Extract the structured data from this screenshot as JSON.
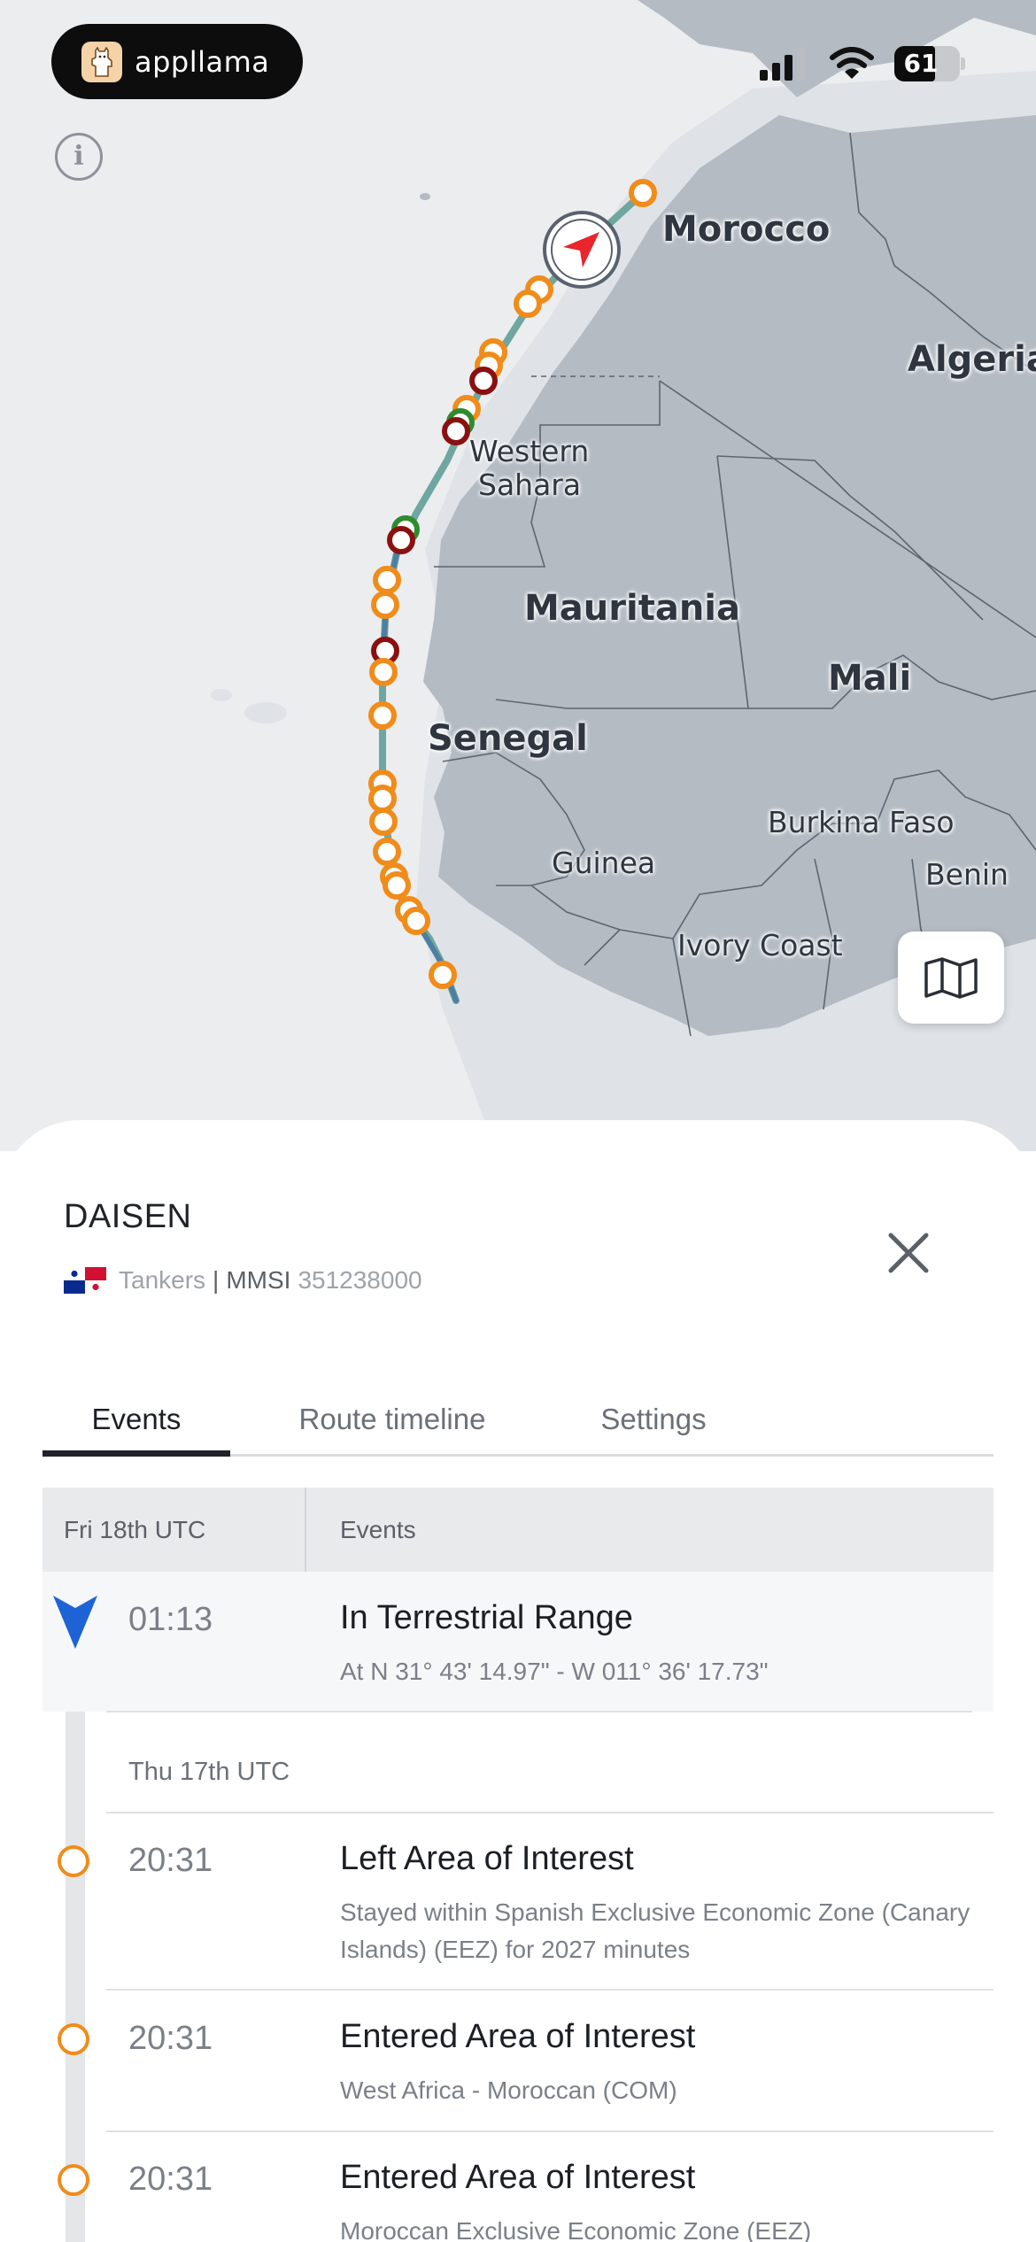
{
  "status_bar": {
    "app_badge": "appllama",
    "battery": "61"
  },
  "map": {
    "labels": {
      "morocco": "Morocco",
      "algeria": "Algeria",
      "western_sahara_1": "Western",
      "western_sahara_2": "Sahara",
      "mauritania": "Mauritania",
      "mali": "Mali",
      "senegal": "Senegal",
      "burkina_faso": "Burkina Faso",
      "guinea": "Guinea",
      "benin": "Benin",
      "ivory_coast": "Ivory Coast"
    },
    "colors": {
      "land": "#b4bbc3",
      "sea": "#ebedef",
      "route": "#6fa6a0",
      "event_orange": "#f08c1a",
      "event_red": "#8b1010",
      "event_green": "#2e8b2e",
      "vessel_marker": "#e8262b"
    }
  },
  "vessel": {
    "name": "DAISEN",
    "type": "Tankers",
    "separator": "|",
    "mmsi_label": "MMSI",
    "mmsi": "351238000",
    "flag": "panama-flag"
  },
  "tabs": [
    {
      "label": "Events"
    },
    {
      "label": "Route timeline"
    },
    {
      "label": "Settings"
    }
  ],
  "table": {
    "col_date": "Fri 18th UTC",
    "col_events": "Events"
  },
  "events": [
    {
      "time": "01:13",
      "title": "In Terrestrial Range",
      "desc": "At N 31° 43' 14.97\" - W 011° 36' 17.73\""
    },
    {
      "time": "20:31",
      "title": "Left Area of Interest",
      "desc": "Stayed within Spanish Exclusive Economic Zone (Canary Islands) (EEZ) for 2027 minutes"
    },
    {
      "time": "20:31",
      "title": "Entered Area of Interest",
      "desc": "West Africa - Moroccan (COM)"
    },
    {
      "time": "20:31",
      "title": "Entered Area of Interest",
      "desc": "Moroccan Exclusive Economic Zone (EEZ)"
    }
  ],
  "date_groups": {
    "thu": "Thu 17th UTC"
  }
}
